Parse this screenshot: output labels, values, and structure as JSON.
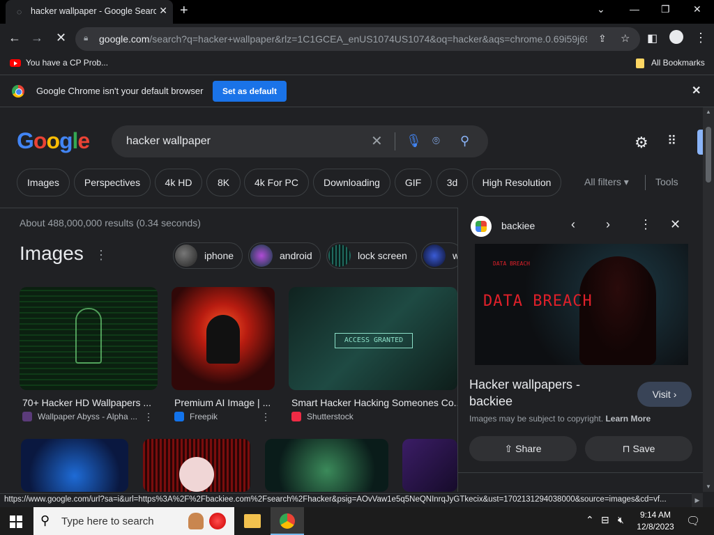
{
  "browser": {
    "tab_title": "hacker wallpaper - Google Search",
    "tab_close": "✕",
    "new_tab": "+",
    "window_controls": {
      "minimize": "—",
      "maximize": "❐",
      "close": "✕",
      "tab_list": "⌄"
    },
    "url_domain": "google.com",
    "url_rest": "/search?q=hacker+wallpaper&rlz=1C1GCEA_enUS1074US1074&oq=hacker&aqs=chrome.0.69i59j69...",
    "bookmarks": {
      "item1": "You have a CP Prob...",
      "all": "All Bookmarks"
    },
    "infobar": {
      "message": "Google Chrome isn't your default browser",
      "button": "Set as default"
    }
  },
  "google": {
    "logo_letters": [
      "G",
      "o",
      "o",
      "g",
      "l",
      "e"
    ],
    "search_query": "hacker wallpaper",
    "chips": [
      "Images",
      "Perspectives",
      "4k HD",
      "8K",
      "4k For PC",
      "Downloading",
      "GIF",
      "3d",
      "High Resolution"
    ],
    "all_filters": "All filters",
    "tools": "Tools",
    "result_stats": "About 488,000,000 results (0.34 seconds)",
    "images_heading": "Images",
    "topics": [
      "iphone",
      "android",
      "lock screen",
      "w"
    ],
    "results": [
      {
        "caption": "70+ Hacker HD Wallpapers ...",
        "source": "Wallpaper Abyss - Alpha ..."
      },
      {
        "caption": "Premium AI Image | ...",
        "source": "Freepik"
      },
      {
        "caption": "Smart Hacker Hacking Someones Co...",
        "source": "Shutterstock"
      }
    ]
  },
  "panel": {
    "site": "backiee",
    "title": "Hacker wallpapers - backiee",
    "visit": "Visit",
    "copyright": "Images may be subject to copyright.",
    "learn_more": "Learn More",
    "share": "Share",
    "save": "Save",
    "image_text": {
      "main": "DATA BREACH",
      "small": "DATA BREACH"
    }
  },
  "status_url": "https://www.google.com/url?sa=i&url=https%3A%2F%2Fbackiee.com%2Fsearch%2Fhacker&psig=AOvVaw1e5q5NeQNInrqJyGTkecix&ust=1702131294038000&source=images&cd=vf...",
  "taskbar": {
    "search_placeholder": "Type here to search",
    "time": "9:14 AM",
    "date": "12/8/2023"
  },
  "colors": {
    "accent": "#1a73e8",
    "bg": "#202124",
    "chip_border": "#3c4043"
  }
}
